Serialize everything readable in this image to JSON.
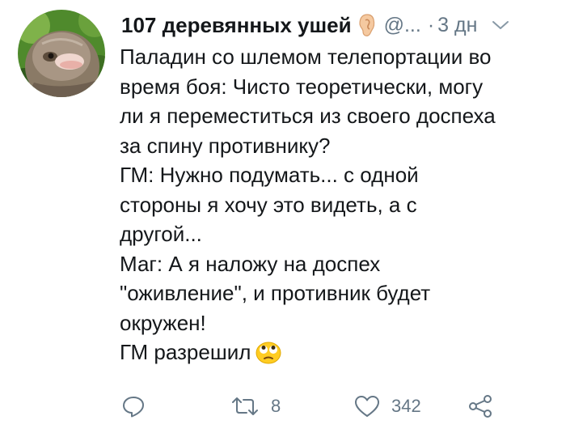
{
  "tweet": {
    "author": {
      "display_name": "107 деревянных ушей",
      "name_emoji": "ear-icon",
      "handle": "@...",
      "avatar": "bird-avatar"
    },
    "separator": "·",
    "timestamp": "3 дн",
    "text_lines": [
      "Паладин со шлемом телепортации во",
      "время боя: Чисто теоретически, могу",
      "ли я переместиться из своего доспеха",
      "за спину противнику?",
      "ГМ: Нужно подумать... с одной",
      "стороны я хочу это видеть, а с",
      "другой...",
      "Маг: А я наложу на доспех",
      "\"оживление\", и противник будет",
      "окружен!",
      "ГМ разрешил"
    ],
    "final_emoji": "face-with-rolling-eyes-icon",
    "actions": {
      "reply_count": "",
      "retweet_count": "8",
      "like_count": "342"
    }
  },
  "colors": {
    "text": "#14171a",
    "secondary": "#657786",
    "background": "#ffffff"
  }
}
